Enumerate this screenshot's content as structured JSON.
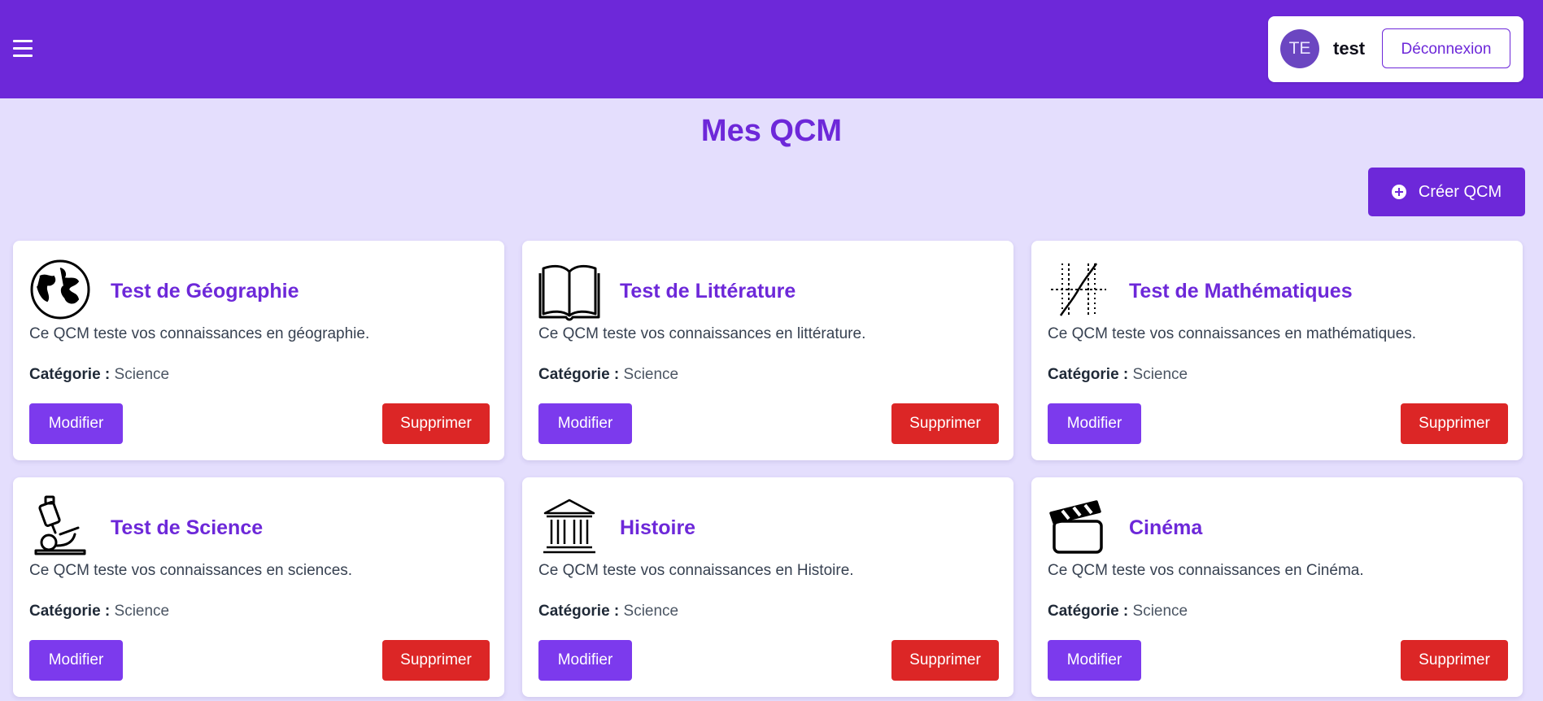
{
  "header": {
    "menu_icon": "hamburger-menu-icon",
    "avatar_initials": "TE",
    "username": "test",
    "logout_label": "Déconnexion"
  },
  "main": {
    "title": "Mes QCM",
    "create_label": "Créer QCM",
    "create_icon": "plus-circle-icon"
  },
  "cards": [
    {
      "icon": "globe-icon",
      "title": "Test de Géographie",
      "description": "Ce QCM teste vos connaissances en géographie.",
      "category_label": "Catégorie :",
      "category_value": "Science",
      "edit_label": "Modifier",
      "delete_label": "Supprimer"
    },
    {
      "icon": "book-icon",
      "title": "Test de Littérature",
      "description": "Ce QCM teste vos connaissances en littérature.",
      "category_label": "Catégorie :",
      "category_value": "Science",
      "edit_label": "Modifier",
      "delete_label": "Supprimer"
    },
    {
      "icon": "math-graph-icon",
      "title": "Test de Mathématiques",
      "description": "Ce QCM teste vos connaissances en mathématiques.",
      "category_label": "Catégorie :",
      "category_value": "Science",
      "edit_label": "Modifier",
      "delete_label": "Supprimer"
    },
    {
      "icon": "microscope-icon",
      "title": "Test de Science",
      "description": "Ce QCM teste vos connaissances en sciences.",
      "category_label": "Catégorie :",
      "category_value": "Science",
      "edit_label": "Modifier",
      "delete_label": "Supprimer"
    },
    {
      "icon": "museum-icon",
      "title": "Histoire",
      "description": "Ce QCM teste vos connaissances en Histoire.",
      "category_label": "Catégorie :",
      "category_value": "Science",
      "edit_label": "Modifier",
      "delete_label": "Supprimer"
    },
    {
      "icon": "clapperboard-icon",
      "title": "Cinéma",
      "description": "Ce QCM teste vos connaissances en Cinéma.",
      "category_label": "Catégorie :",
      "category_value": "Science",
      "edit_label": "Modifier",
      "delete_label": "Supprimer"
    }
  ],
  "colors": {
    "primary": "#6d28d9",
    "button_primary": "#7c3aed",
    "danger": "#dc2626",
    "background": "#e4defd"
  }
}
